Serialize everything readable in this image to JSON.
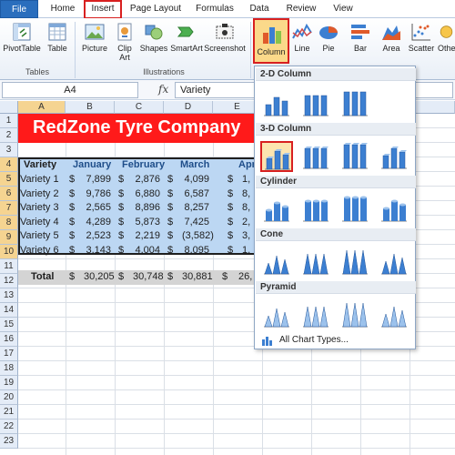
{
  "ribbon": {
    "tabs": [
      "File",
      "Home",
      "Insert",
      "Page Layout",
      "Formulas",
      "Data",
      "Review",
      "View"
    ],
    "buttons": {
      "pivot_table": "PivotTable",
      "table": "Table",
      "picture": "Picture",
      "clip_art_1": "Clip",
      "clip_art_2": "Art",
      "shapes": "Shapes",
      "smartart": "SmartArt",
      "screenshot": "Screenshot",
      "column": "Column",
      "line": "Line",
      "pie": "Pie",
      "bar": "Bar",
      "area": "Area",
      "scatter": "Scatter",
      "other": "Othe"
    },
    "groups": {
      "tables": "Tables",
      "illustrations": "Illustrations"
    }
  },
  "formula_bar": {
    "name_box": "A4",
    "fx": "fx",
    "value": "Variety"
  },
  "grid": {
    "columns": [
      "A",
      "B",
      "C",
      "D",
      "E"
    ],
    "rows": [
      "1",
      "2",
      "3",
      "4",
      "5",
      "6",
      "7",
      "8",
      "9",
      "10",
      "11",
      "12",
      "13",
      "14",
      "15",
      "16",
      "17",
      "18",
      "19",
      "20",
      "21",
      "22",
      "23"
    ]
  },
  "sheet": {
    "title": "RedZone Tyre Company",
    "headers": [
      "Variety",
      "January",
      "February",
      "March",
      "Apri"
    ],
    "rows": [
      {
        "name": "Variety 1",
        "jan": "7,899",
        "feb": "2,876",
        "mar": "4,099",
        "apr": "1,"
      },
      {
        "name": "Variety 2",
        "jan": "9,786",
        "feb": "6,880",
        "mar": "6,587",
        "apr": "8,"
      },
      {
        "name": "Variety 3",
        "jan": "2,565",
        "feb": "8,896",
        "mar": "8,257",
        "apr": "8,"
      },
      {
        "name": "Variety 4",
        "jan": "4,289",
        "feb": "5,873",
        "mar": "7,425",
        "apr": "2,"
      },
      {
        "name": "Variety 5",
        "jan": "2,523",
        "feb": "2,219",
        "mar": "(3,582)",
        "apr": "3,"
      },
      {
        "name": "Variety 6",
        "jan": "3,143",
        "feb": "4,004",
        "mar": "8,095",
        "apr": "1,"
      }
    ],
    "currency": "$",
    "total": {
      "label": "Total",
      "jan": "30,205",
      "feb": "30,748",
      "mar": "30,881",
      "apr": "26,"
    }
  },
  "dropdown": {
    "sections": [
      "2-D Column",
      "3-D Column",
      "Cylinder",
      "Cone",
      "Pyramid"
    ],
    "footer": "All Chart Types..."
  },
  "colors": {
    "title_band": "#ff1a1a",
    "table_highlight": "#bcd7f3",
    "selection_outline": "#d82020",
    "file_tab": "#2a6ebd"
  }
}
